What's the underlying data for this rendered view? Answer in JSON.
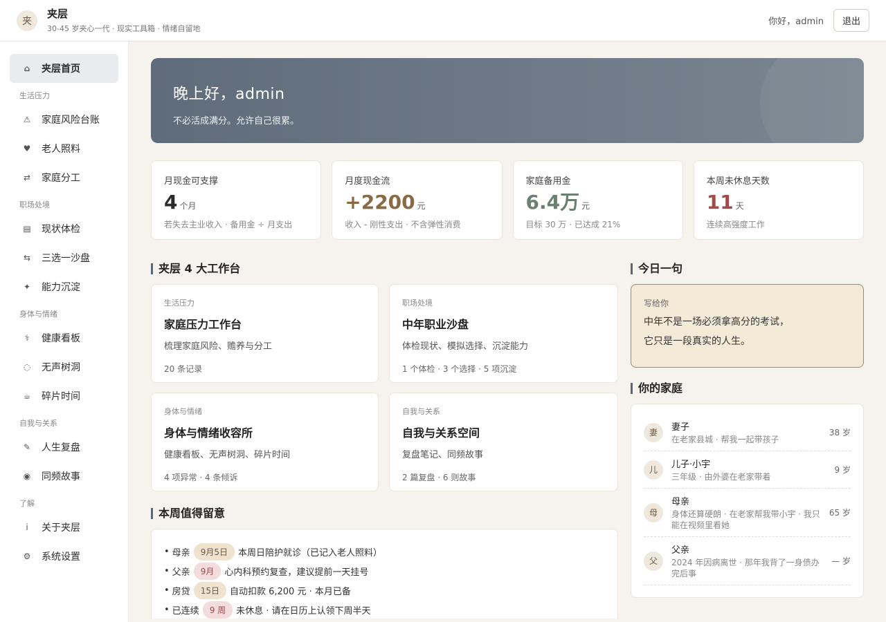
{
  "header": {
    "logo_char": "夹",
    "title": "夹层",
    "subtitle": "30-45 岁夹心一代 · 现实工具箱 · 情绪自留地",
    "greeting": "你好，admin",
    "logout": "退出"
  },
  "sidebar": {
    "home": {
      "icon": "⌂",
      "label": "夹层首页"
    },
    "sections": [
      {
        "title": "生活压力",
        "items": [
          {
            "icon": "⚠",
            "label": "家庭风险台账"
          },
          {
            "icon": "♥",
            "label": "老人照料"
          },
          {
            "icon": "⇄",
            "label": "家庭分工"
          }
        ]
      },
      {
        "title": "职场处境",
        "items": [
          {
            "icon": "▤",
            "label": "现状体检"
          },
          {
            "icon": "⇆",
            "label": "三选一沙盘"
          },
          {
            "icon": "✦",
            "label": "能力沉淀"
          }
        ]
      },
      {
        "title": "身体与情绪",
        "items": [
          {
            "icon": "⚕",
            "label": "健康看板"
          },
          {
            "icon": "◌",
            "label": "无声树洞"
          },
          {
            "icon": "☕",
            "label": "碎片时间"
          }
        ]
      },
      {
        "title": "自我与关系",
        "items": [
          {
            "icon": "✎",
            "label": "人生复盘"
          },
          {
            "icon": "◉",
            "label": "同频故事"
          }
        ]
      },
      {
        "title": "了解",
        "items": [
          {
            "icon": "i",
            "label": "关于夹层"
          },
          {
            "icon": "⚙",
            "label": "系统设置"
          }
        ]
      }
    ]
  },
  "hero": {
    "title": "晚上好，admin",
    "subtitle": "不必活成满分。允许自己很累。"
  },
  "stats": [
    {
      "label": "月现金可支撑",
      "value": "4",
      "unit": "个月",
      "note": "若失去主业收入 · 备用金 ÷ 月支出",
      "color": "#2b2b2b"
    },
    {
      "label": "月度现金流",
      "value": "+2200",
      "unit": "元",
      "note": "收入 - 刚性支出 · 不含弹性消费",
      "color": "#8a6a45"
    },
    {
      "label": "家庭备用金",
      "value": "6.4万",
      "unit": "元",
      "note": "目标 30 万 · 已达成 21%",
      "color": "#6b8070"
    },
    {
      "label": "本周未休息天数",
      "value": "11",
      "unit": "天",
      "note": "连续高强度工作",
      "color": "#a34b4b"
    }
  ],
  "workbench": {
    "title": "夹层 4 大工作台",
    "cards": [
      {
        "tag": "生活压力",
        "title": "家庭压力工作台",
        "desc": "梳理家庭风险、赡养与分工",
        "meta": "20 条记录"
      },
      {
        "tag": "职场处境",
        "title": "中年职业沙盘",
        "desc": "体检现状、模拟选择、沉淀能力",
        "meta": "1 个体检 · 3 个选择 · 5 项沉淀"
      },
      {
        "tag": "身体与情绪",
        "title": "身体与情绪收容所",
        "desc": "健康看板、无声树洞、碎片时间",
        "meta": "4 项异常 · 4 条倾诉"
      },
      {
        "tag": "自我与关系",
        "title": "自我与关系空间",
        "desc": "复盘笔记、同频故事",
        "meta": "2 篇复盘 · 6 则故事"
      }
    ]
  },
  "week": {
    "title": "本周值得留意",
    "items": [
      {
        "who": "母亲",
        "pill": "9月5日",
        "pill_style": "tan",
        "text": "本周日陪护就诊（已记入老人照料）"
      },
      {
        "who": "父亲",
        "pill": "9月",
        "pill_style": "red",
        "text": "心内科预约复查，建议提前一天挂号"
      },
      {
        "who": "房贷",
        "pill": "15日",
        "pill_style": "tan",
        "text": "自动扣款 6,200 元 · 本月已备"
      },
      {
        "who": "已连续",
        "pill": "9 周",
        "pill_style": "red",
        "text": "未休息 · 请在日历上认领下周半天"
      }
    ]
  },
  "quote": {
    "title": "今日一句",
    "tag": "写给你",
    "line1": "中年不是一场必须拿高分的考试，",
    "line2": "它只是一段真实的人生。"
  },
  "family": {
    "title": "你的家庭",
    "members": [
      {
        "avatar": "妻",
        "name": "妻子",
        "desc": "在老家县城 · 帮我一起带孩子",
        "age": "38 岁"
      },
      {
        "avatar": "儿",
        "name": "儿子·小宇",
        "desc": "三年级 · 由外婆在老家带着",
        "age": "9 岁"
      },
      {
        "avatar": "母",
        "name": "母亲",
        "desc": "身体还算硬朗 · 在老家帮我带小宇 · 我只能在视频里看她",
        "age": "65 岁"
      },
      {
        "avatar": "父",
        "name": "父亲",
        "desc": "2024 年因病离世 · 那年我背了一身债办完后事",
        "age": "— 岁"
      }
    ]
  }
}
